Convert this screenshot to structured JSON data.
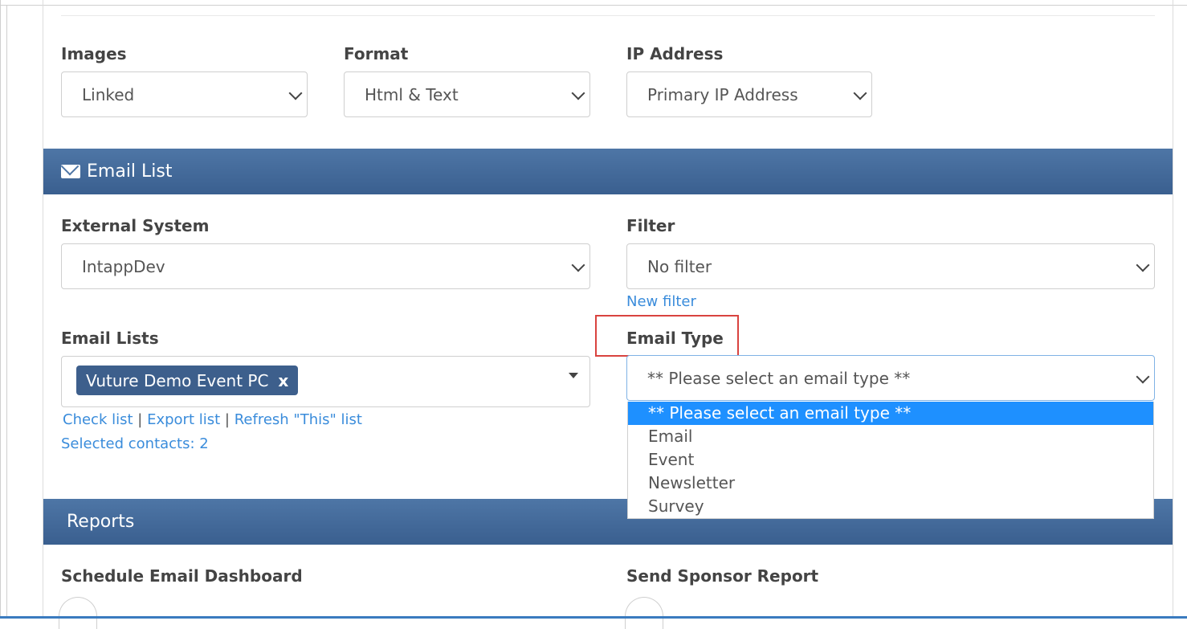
{
  "top_fields": {
    "images": {
      "label": "Images",
      "value": "Linked"
    },
    "format": {
      "label": "Format",
      "value": "Html & Text"
    },
    "ip": {
      "label": "IP Address",
      "value": "Primary IP Address"
    }
  },
  "email_list_section": {
    "title": "Email List",
    "icon": "envelope-icon",
    "external_system": {
      "label": "External System",
      "value": "IntappDev"
    },
    "filter": {
      "label": "Filter",
      "value": "No filter",
      "link": "New filter"
    },
    "email_lists": {
      "label": "Email Lists",
      "tag": "Vuture Demo Event PC",
      "tag_remove": "x",
      "links": [
        "Check list",
        "Export list",
        "Refresh \"This\" list"
      ],
      "separator": "|",
      "selected_contacts": "Selected contacts: 2"
    },
    "email_type": {
      "label": "Email Type",
      "value": "** Please select an email type **",
      "options": [
        "** Please select an email type **",
        "Email",
        "Event",
        "Newsletter",
        "Survey"
      ]
    }
  },
  "reports_section": {
    "title": "Reports",
    "schedule_label": "Schedule Email Dashboard",
    "sponsor_label": "Send Sponsor Report"
  },
  "colors": {
    "section_bar": "#3f6596",
    "link": "#3a8cdb",
    "tag_bg": "#3d5f8c",
    "selected_option": "#1e90ff",
    "highlight": "#d9433f"
  }
}
